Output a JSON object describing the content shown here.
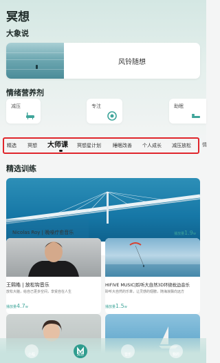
{
  "header": {
    "title": "冥想"
  },
  "master": {
    "section_title": "大象说",
    "card_label": "风铃随想"
  },
  "mood": {
    "section_title": "情绪营养剂",
    "items": [
      {
        "label": "减压",
        "icon": "bathtub-icon"
      },
      {
        "label": "专注",
        "icon": "target-icon"
      },
      {
        "label": "助眠",
        "icon": "bed-icon"
      }
    ]
  },
  "tabs": {
    "items": [
      "精选",
      "冥想",
      "大师课",
      "冥想星计划",
      "睡眠改善",
      "个人成长",
      "减压放松"
    ],
    "overflow": "情",
    "active_index": 2
  },
  "featured": {
    "section_title": "精选训练",
    "main_card": {
      "title": "Nicolas Roy | 晚噪疗愈音乐",
      "plays_prefix": "播放量",
      "plays_value": "1.9",
      "plays_unit": "w"
    },
    "cards": [
      {
        "title": "王熙皓 | 放松钩音乐",
        "desc": "放松大脑，给自己更多空间，享受自在人生",
        "plays_prefix": "播放量",
        "plays_value": "4.7",
        "plays_unit": "w"
      },
      {
        "title": "HIFIVE MUSIC|聆听大自然3D环绕枕边音乐",
        "desc": "聆听大自然的乐章，让灵感的翅膀，随海浪飘向远方",
        "plays_prefix": "播放量",
        "plays_value": "1.5",
        "plays_unit": "w"
      }
    ]
  },
  "bottom_nav": {
    "items": [
      "小程",
      "冥想",
      "音乐",
      "我的"
    ],
    "active_index": 1
  },
  "colors": {
    "accent": "#2f9c8e",
    "highlight_border": "#e0252b",
    "background": "#f4f5f5"
  }
}
